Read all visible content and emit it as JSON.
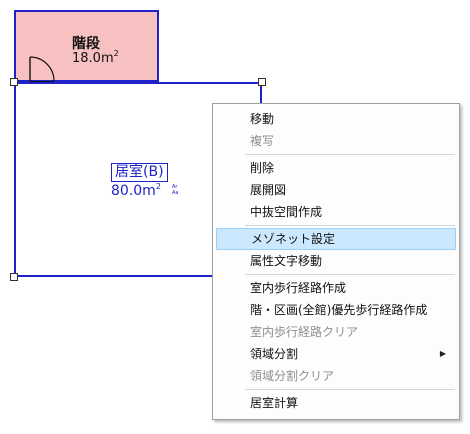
{
  "floor_plan": {
    "stair_room": {
      "name": "階段",
      "area": "18.0",
      "area_unit": "m",
      "area_unit_sup": "2",
      "fill_color": "#f7c1c1",
      "border_color": "#1f22c8"
    },
    "living_room": {
      "name": "居室(B)",
      "area": "80.0",
      "area_unit": "m",
      "area_unit_sup": "2",
      "area_marks": [
        "Ar",
        "Aa"
      ],
      "border_color": "#1f22c8"
    }
  },
  "context_menu": {
    "items": [
      {
        "label": "移動",
        "enabled": true
      },
      {
        "label": "複写",
        "enabled": false
      },
      {
        "label": "削除",
        "enabled": true
      },
      {
        "label": "展開図",
        "enabled": true
      },
      {
        "label": "中抜空間作成",
        "enabled": true
      },
      {
        "label": "メゾネット設定",
        "enabled": true,
        "highlighted": true
      },
      {
        "label": "属性文字移動",
        "enabled": true
      },
      {
        "label": "室内歩行経路作成",
        "enabled": true
      },
      {
        "label": "階・区画(全館)優先歩行経路作成",
        "enabled": true
      },
      {
        "label": "室内歩行経路クリア",
        "enabled": false
      },
      {
        "label": "領域分割",
        "enabled": true,
        "submenu": true,
        "submenu_arrow": "▶"
      },
      {
        "label": "領域分割クリア",
        "enabled": false
      },
      {
        "label": "居室計算",
        "enabled": true
      }
    ],
    "highlight_color": "#cce8ff"
  }
}
